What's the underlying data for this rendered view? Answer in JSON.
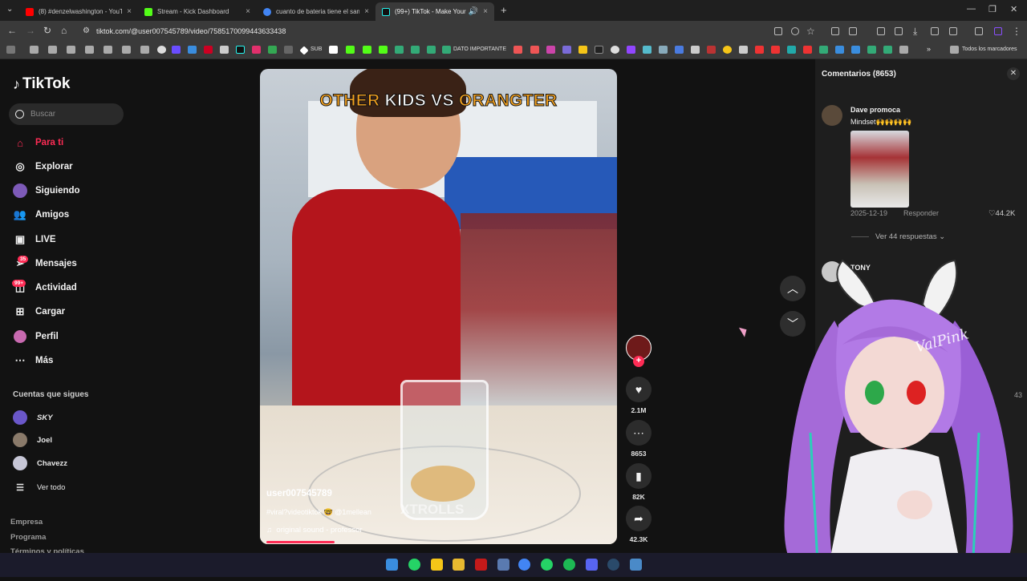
{
  "browser": {
    "tabs": [
      {
        "label": "(8) #denzelwashington - YouTu",
        "color": "#ff0000"
      },
      {
        "label": "Stream - Kick Dashboard",
        "color": "#53fc18"
      },
      {
        "label": "cuanto de bateria tiene el sams",
        "color": "#4285f4"
      },
      {
        "label": "(99+) TikTok - Make Your Da",
        "color": "#111111"
      }
    ],
    "new_tab": "+",
    "url": "tiktok.com/@user007545789/video/7585170099443633438",
    "bookmarks": {
      "sub_label": "SUB",
      "dato_label": "DATO IMPORTANTE",
      "all_label": "Todos los marcadores"
    }
  },
  "tiktok": {
    "logo": "TikTok",
    "search_placeholder": "Buscar",
    "nav": [
      {
        "label": "Para ti",
        "icon": "home-icon"
      },
      {
        "label": "Explorar",
        "icon": "compass-icon"
      },
      {
        "label": "Siguiendo",
        "icon": "following-icon"
      },
      {
        "label": "Amigos",
        "icon": "friends-icon"
      },
      {
        "label": "LIVE",
        "icon": "live-icon"
      },
      {
        "label": "Mensajes",
        "icon": "messages-icon",
        "badge": "35"
      },
      {
        "label": "Actividad",
        "icon": "activity-icon",
        "badge": "99+"
      },
      {
        "label": "Cargar",
        "icon": "upload-icon"
      },
      {
        "label": "Perfil",
        "icon": "profile-icon"
      },
      {
        "label": "Más",
        "icon": "more-icon"
      }
    ],
    "following_title": "Cuentas que sigues",
    "following": [
      {
        "name": "SKY"
      },
      {
        "name": "Joel"
      },
      {
        "name": "Chavezz"
      }
    ],
    "see_all": "Ver todo",
    "footer": [
      "Empresa",
      "Programa",
      "Términos y políticas"
    ]
  },
  "video": {
    "title_part1": "OTHER",
    "title_part2": "KIDS VS",
    "title_part3": "ORANGTER",
    "username": "user007545789",
    "caption": "#viral?videotiktok 🤓 @1mellean",
    "sound": "original sound - professor",
    "watermark": "XTROLLS"
  },
  "actions": {
    "likes": "2.1M",
    "comments": "8653",
    "saves": "82K",
    "shares": "42.3K"
  },
  "comments_panel": {
    "title": "Comentarios (8653)",
    "items": [
      {
        "user": "Dave promoca",
        "text": "Mindset🙌🙌🙌🙌",
        "date": "2025-12-19",
        "reply": "Responder",
        "likes": "44.2K",
        "see_replies": "Ver 44 respuestas"
      },
      {
        "user": "TONY"
      }
    ],
    "partial_count": "43"
  },
  "overlay": {
    "vtuber_name": "ValPink"
  }
}
